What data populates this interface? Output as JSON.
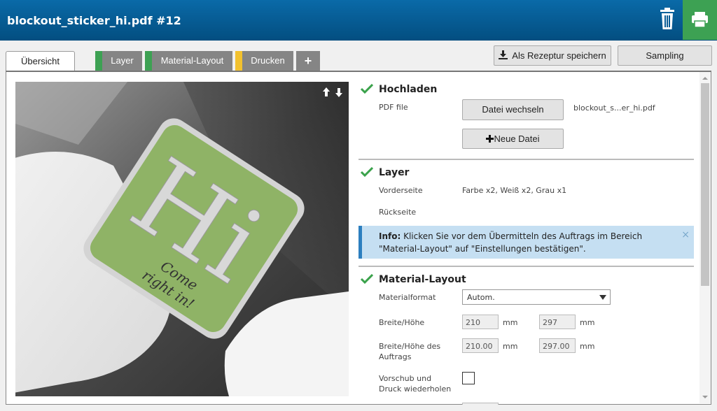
{
  "header": {
    "title": "blockout_sticker_hi.pdf #12",
    "trash_icon": "trash-icon",
    "print_icon": "printer-icon"
  },
  "tabs": [
    {
      "label": "Übersicht",
      "active": true
    },
    {
      "label": "Layer",
      "marker_color": "#3da153"
    },
    {
      "label": "Material-Layout",
      "marker_color": "#3da153"
    },
    {
      "label": "Drucken",
      "marker_color": "#f2c12e"
    },
    {
      "label": "+"
    }
  ],
  "actions": {
    "save_recipe": "Als Rezeptur speichern",
    "sampling": "Sampling"
  },
  "preview": {
    "sticker_text_big": "Hi",
    "sticker_text_small_1": "Come",
    "sticker_text_small_2": "right in!"
  },
  "upload": {
    "title": "Hochladen",
    "pdf_label": "PDF file",
    "change_file": "Datei wechseln",
    "new_file": "Neue Datei",
    "filename": "blockout_s...er_hi.pdf"
  },
  "layer": {
    "title": "Layer",
    "front_label": "Vorderseite",
    "front_value": "Farbe x2, Weiß x2, Grau x1",
    "back_label": "Rückseite"
  },
  "info": {
    "prefix": "Info:",
    "text": " Klicken Sie vor dem Übermitteln des Auftrags im Bereich \"Material-Layout\" auf \"Einstellungen bestätigen\".",
    "close": "×"
  },
  "material": {
    "title": "Material-Layout",
    "format_label": "Materialformat",
    "format_value": "Autom.",
    "wh_label": "Breite/Höhe",
    "width": "210",
    "height": "297",
    "unit": "mm",
    "job_wh_label_1": "Breite/Höhe des",
    "job_wh_label_2": "Auftrags",
    "job_width": "210.00",
    "job_height": "297.00",
    "repeat_label_1": "Vorschub und",
    "repeat_label_2": "Druck wiederholen",
    "repeat_checked": false
  },
  "colors": {
    "header_top": "#0a6aa8",
    "print_green": "#3da153",
    "check_green": "#3aa24b",
    "info_bg": "#c5dff2"
  }
}
